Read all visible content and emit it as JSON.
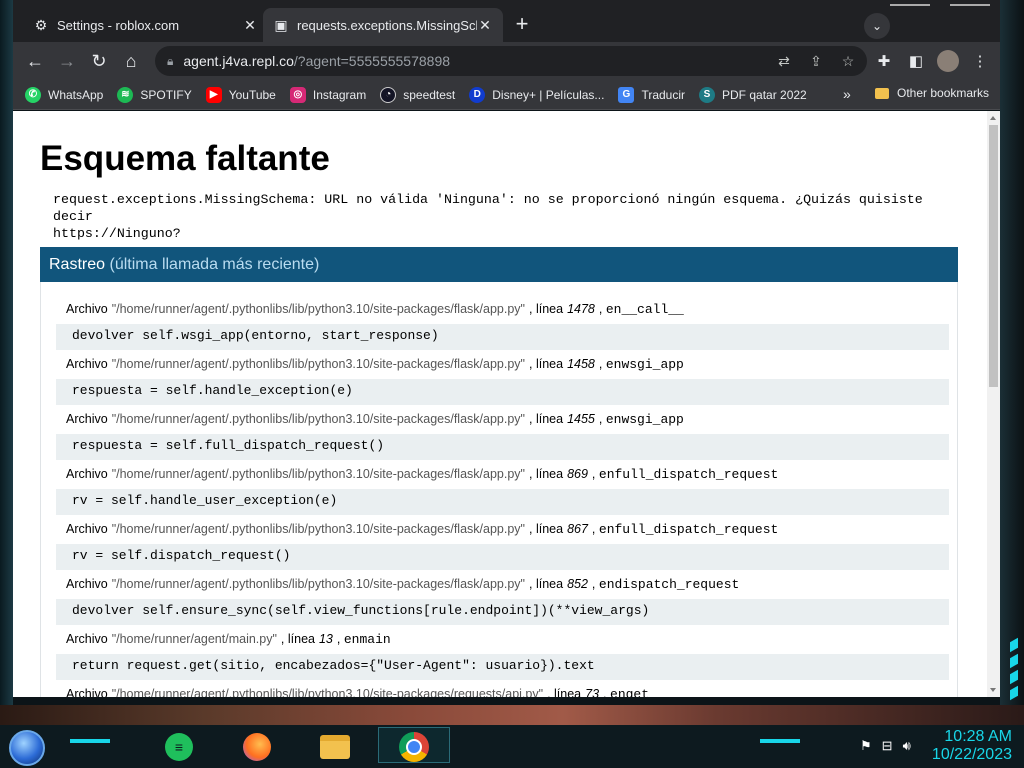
{
  "browser": {
    "tabs": [
      {
        "title": "Settings - roblox.com",
        "icon": "gear-icon",
        "active": false
      },
      {
        "title": "requests.exceptions.MissingSchema",
        "icon": "terminal-icon",
        "active": true
      }
    ],
    "address": {
      "host": "agent.j4va.repl.co",
      "path": "/?agent=5555555578898"
    },
    "bookmarks": [
      {
        "label": "WhatsApp",
        "icon": "whatsapp-icon",
        "color": "#25d366"
      },
      {
        "label": "SPOTIFY",
        "icon": "spotify-icon",
        "color": "#1db954"
      },
      {
        "label": "YouTube",
        "icon": "youtube-icon",
        "color": "#ff0000"
      },
      {
        "label": "Instagram",
        "icon": "instagram-icon",
        "color": "#d62976"
      },
      {
        "label": "speedtest",
        "icon": "speedtest-icon",
        "color": "#141526"
      },
      {
        "label": "Disney+ | Películas...",
        "icon": "disney-icon",
        "color": "#113ccf"
      },
      {
        "label": "Traducir",
        "icon": "translate-icon",
        "color": "#4285f4"
      },
      {
        "label": "PDF qatar 2022",
        "icon": "scribd-icon",
        "color": "#1e7b85"
      }
    ],
    "other_bookmarks": "Other bookmarks"
  },
  "page": {
    "title": "Esquema faltante",
    "error_message": "request.exceptions.MissingSchema: URL no válida 'Ninguna': no se proporcionó ningún esquema. ¿Quizás quisiste decir\nhttps://Ninguno?",
    "traceback_title": "Rastreo",
    "traceback_subtitle": "(última llamada más reciente)",
    "file_word": "Archivo",
    "line_word": "línea",
    "frames": [
      {
        "file": "\"/home/runner/agent/.pythonlibs/lib/python3.10/site-packages/flask/app.py\"",
        "line": "1478",
        "func": "en__call__",
        "code": "devolver self.wsgi_app(entorno, start_response)"
      },
      {
        "file": "\"/home/runner/agent/.pythonlibs/lib/python3.10/site-packages/flask/app.py\"",
        "line": "1458",
        "func": "enwsgi_app",
        "code": "respuesta = self.handle_exception(e)"
      },
      {
        "file": "\"/home/runner/agent/.pythonlibs/lib/python3.10/site-packages/flask/app.py\"",
        "line": "1455",
        "func": "enwsgi_app",
        "code": "respuesta = self.full_dispatch_request()"
      },
      {
        "file": "\"/home/runner/agent/.pythonlibs/lib/python3.10/site-packages/flask/app.py\"",
        "line": "869",
        "func": "enfull_dispatch_request",
        "code": "rv = self.handle_user_exception(e)"
      },
      {
        "file": "\"/home/runner/agent/.pythonlibs/lib/python3.10/site-packages/flask/app.py\"",
        "line": "867",
        "func": "enfull_dispatch_request",
        "code": "rv = self.dispatch_request()"
      },
      {
        "file": "\"/home/runner/agent/.pythonlibs/lib/python3.10/site-packages/flask/app.py\"",
        "line": "852",
        "func": "endispatch_request",
        "code": "devolver self.ensure_sync(self.view_functions[rule.endpoint])(**view_args)"
      },
      {
        "file": "\"/home/runner/agent/main.py\"",
        "line": "13",
        "func": "enmain",
        "code": "return request.get(sitio, encabezados={\"User-Agent\": usuario}).text"
      },
      {
        "file": "\"/home/runner/agent/.pythonlibs/lib/python3.10/site-packages/requests/api.py\"",
        "line": "73",
        "func": "enget",
        "code": ""
      }
    ]
  },
  "taskbar": {
    "apps": [
      "start-orb-icon",
      "notes-icon",
      "firefox-icon",
      "file-explorer-icon",
      "chrome-icon"
    ],
    "time": "10:28 AM",
    "date": "10/22/2023"
  },
  "colors": {
    "accent": "#18d6e8",
    "traceback_header": "#11557c"
  }
}
